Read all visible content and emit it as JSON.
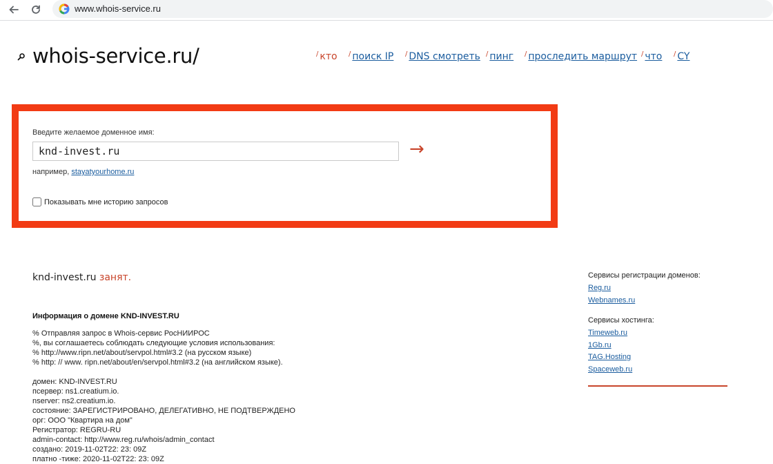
{
  "browser": {
    "url": "www.whois-service.ru"
  },
  "header": {
    "logo": "whois-service.ru/",
    "nav": [
      {
        "label": "кто",
        "current": true
      },
      {
        "label": "поиск IP"
      },
      {
        "label": "DNS смотреть"
      },
      {
        "label": "пинг"
      },
      {
        "label": "проследить маршрут"
      },
      {
        "label": "что"
      },
      {
        "label": "CY"
      }
    ]
  },
  "search": {
    "label": "Введите желаемое доменное имя:",
    "value": "knd-invest.ru",
    "submit_icon": "arrow-right",
    "example_prefix": "например,",
    "example_link": "stayatyourhome.ru",
    "history_label": "Показывать мне историю запросов",
    "history_checked": false
  },
  "result": {
    "domain": "knd-invest.ru",
    "status": "занят.",
    "info_title": "Информация о домене KND-INVEST.RU",
    "notice_lines": [
      "% Отправляя запрос в Whois-сервис РосНИИРОС",
      "%, вы соглашаетесь соблюдать следующие условия использования:",
      "% http://www.ripn.net/about/servpol.html#3.2 (на русском языке)",
      "% http: // www. ripn.net/about/en/servpol.html#3.2 (на английском языке)."
    ],
    "record_lines": [
      "домен: KND-INVEST.RU",
      "псервер: ns1.creatium.io.",
      "nserver: ns2.creatium.io.",
      "состояние: ЗАРЕГИСТРИРОВАНО, ДЕЛЕГАТИВНО, НЕ ПОДТВЕРЖДЕНО",
      "орг: ООО \"Квартира на дом\"",
      "Регистратор: REGRU-RU",
      "admin-contact: http://www.reg.ru/whois/admin_contact",
      "создано: 2019-11-02T22: 23: 09Z",
      "платно -тиже: 2020-11-02T22: 23: 09Z"
    ]
  },
  "sidebar": {
    "registrars_title": "Сервисы регистрации доменов:",
    "registrars": [
      "Reg.ru",
      "Webnames.ru"
    ],
    "hosting_title": "Сервисы хостинга:",
    "hosting": [
      "Timeweb.ru",
      "1Gb.ru",
      "TAG.Hosting",
      "Spaceweb.ru"
    ]
  },
  "colors": {
    "accent": "#f23b14",
    "link": "#1a5c9e",
    "busy": "#c8442a"
  }
}
